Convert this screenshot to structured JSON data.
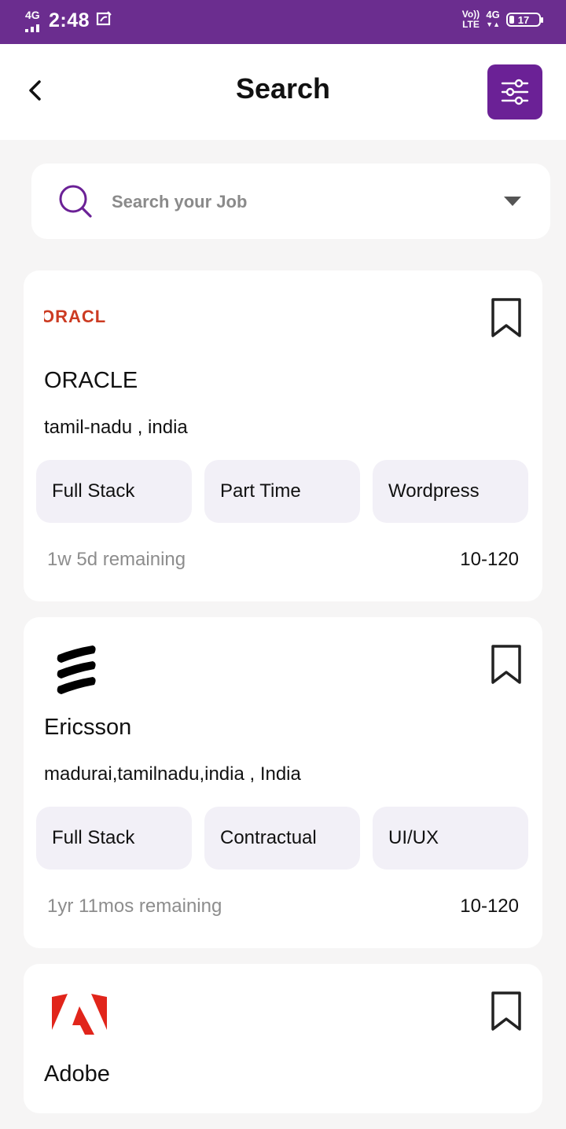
{
  "status_bar": {
    "network_left": "4G",
    "time": "2:48",
    "volte_top": "Vo))",
    "volte_bottom": "LTE",
    "network_right": "4G",
    "battery": "17"
  },
  "header": {
    "title": "Search"
  },
  "search": {
    "placeholder": "Search your Job"
  },
  "jobs": [
    {
      "logo_text": "ORACL",
      "company": "ORACLE",
      "location": "tamil-nadu , india",
      "tags": [
        "Full Stack",
        "Part Time",
        "Wordpress"
      ],
      "remaining": "1w 5d remaining",
      "salary": "10-120"
    },
    {
      "company": "Ericsson",
      "location": "madurai,tamilnadu,india , India",
      "tags": [
        "Full Stack",
        "Contractual",
        "UI/UX"
      ],
      "remaining": "1yr 11mos remaining",
      "salary": "10-120"
    },
    {
      "company": "Adobe"
    }
  ],
  "colors": {
    "brand_purple": "#6b2196",
    "status_bar": "#6b2d8f",
    "tag_bg": "#f2f0f7",
    "oracle_red": "#cc3b22"
  }
}
